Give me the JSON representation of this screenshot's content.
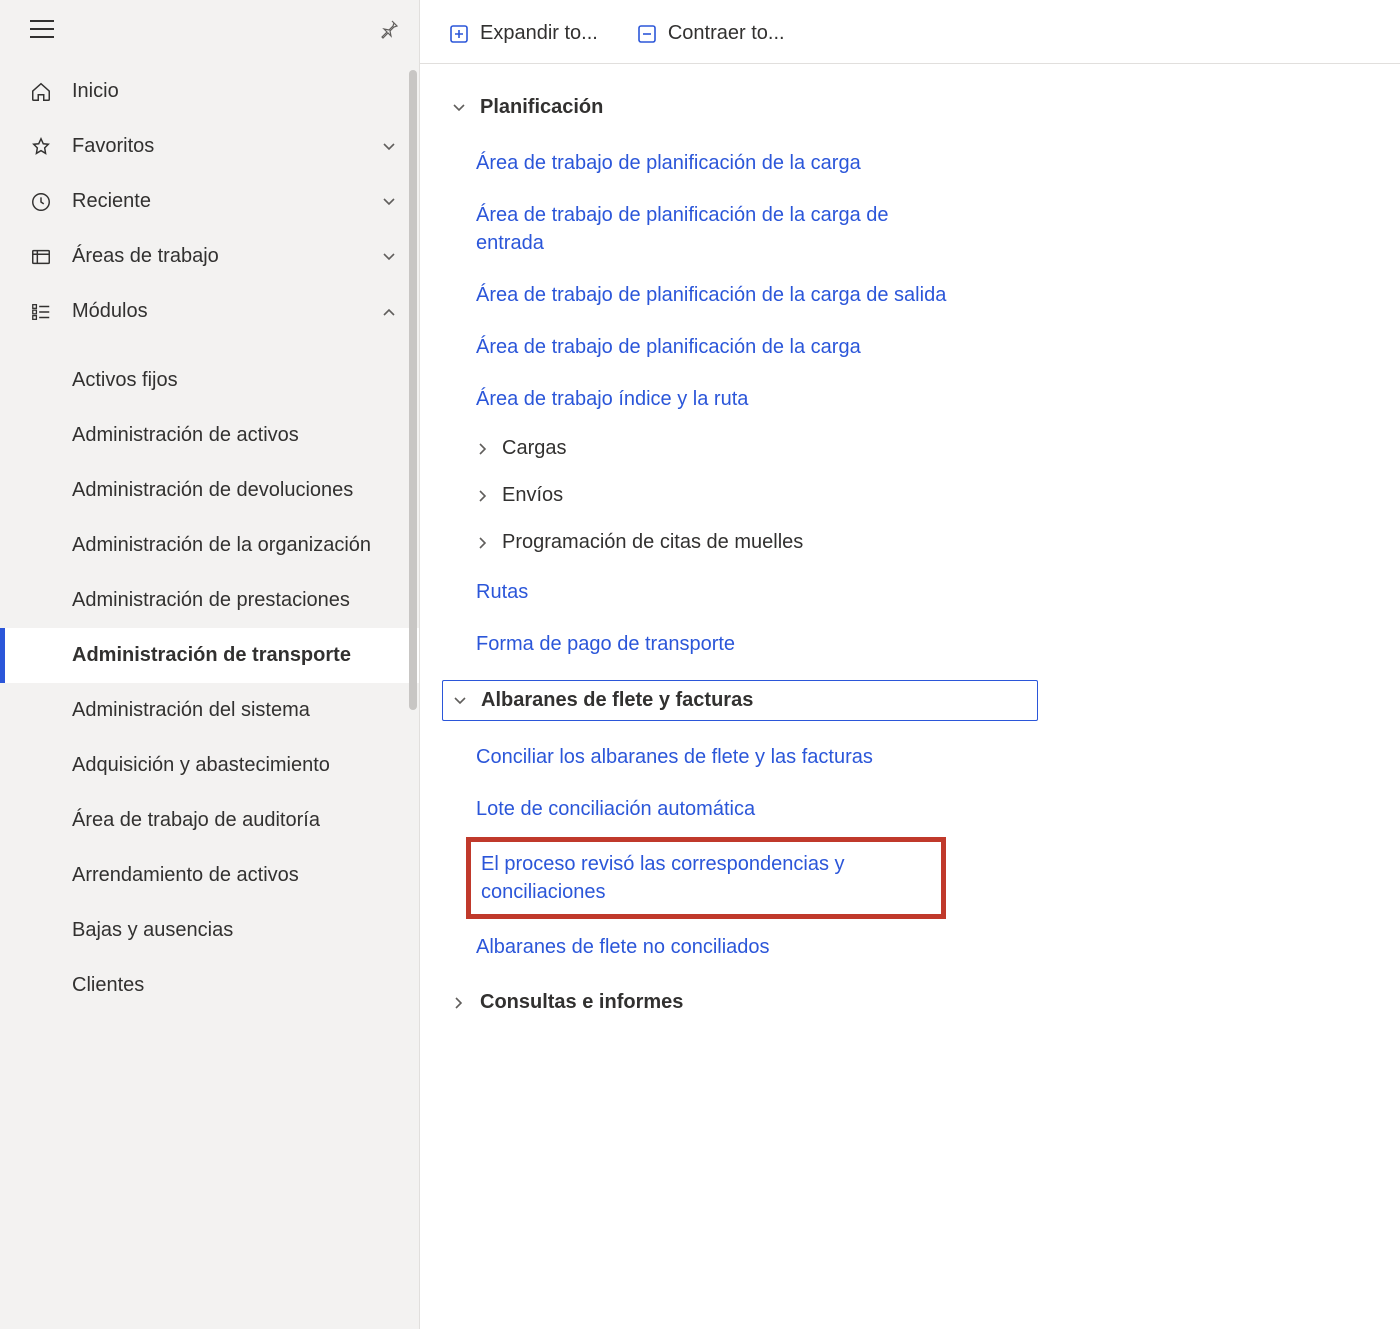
{
  "sidebar": {
    "nav": {
      "home": "Inicio",
      "favorites": "Favoritos",
      "recent": "Reciente",
      "workspaces": "Áreas de trabajo",
      "modules": "Módulos"
    },
    "modules": [
      "Activos fijos",
      "Administración de activos",
      "Administración de devoluciones",
      "Administración de la organización",
      "Administración de prestaciones",
      "Administración de transporte",
      "Administración del sistema",
      "Adquisición y abastecimiento",
      "Área de trabajo de auditoría",
      "Arrendamiento de activos",
      "Bajas y ausencias",
      "Clientes"
    ],
    "active_module_index": 5
  },
  "toolbar": {
    "expand": "Expandir to...",
    "collapse": "Contraer to..."
  },
  "sections": {
    "planning": {
      "title": "Planificación",
      "links": [
        "Área de trabajo de planificación de la carga",
        "Área de trabajo de planificación de la carga de entrada",
        "Área de trabajo de planificación de la carga de salida",
        "Área de trabajo de planificación de la carga",
        "Área de trabajo índice y la ruta"
      ],
      "subgroups": [
        "Cargas",
        "Envíos",
        "Programación de citas de muelles"
      ],
      "trailing_links": [
        "Rutas",
        "Forma de pago de transporte"
      ]
    },
    "freight": {
      "title": "Albaranes de flete y facturas",
      "links": [
        "Conciliar los albaranes de flete y las facturas",
        "Lote de conciliación automática",
        "El proceso revisó las correspondencias y conciliaciones",
        "Albaranes de flete no conciliados"
      ],
      "highlighted_index": 2
    },
    "reports": {
      "title": "Consultas e informes"
    }
  }
}
